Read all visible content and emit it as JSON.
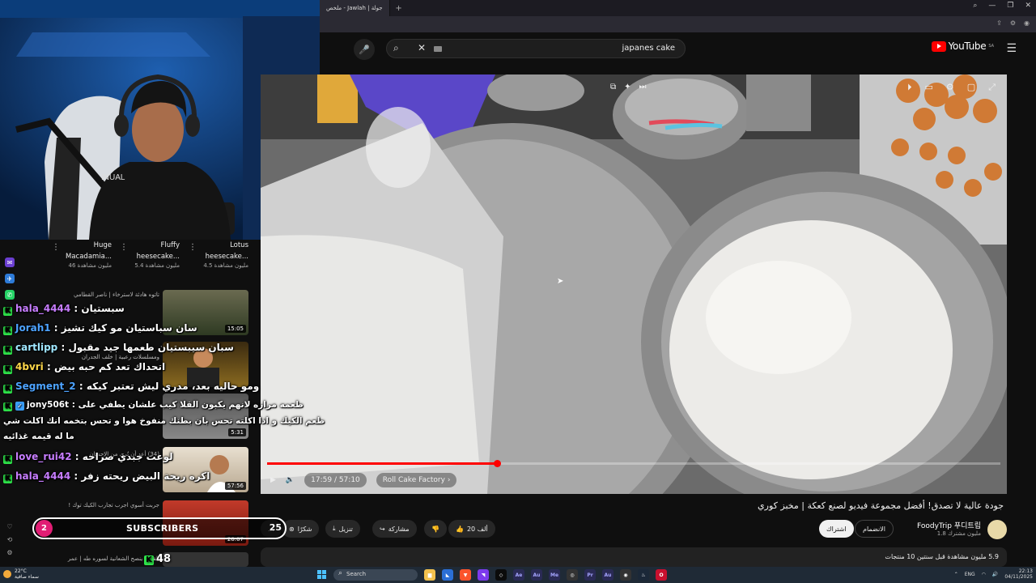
{
  "browser": {
    "tab_title": "ملخص - Jawlah | جولة",
    "tab_plus": "+",
    "win_min": "—",
    "win_max": "❐",
    "win_close": "✕",
    "search_zoom": "⌕"
  },
  "youtube": {
    "search_query": "japanes cake",
    "logo_text": "YouTube",
    "logo_region": "SA"
  },
  "player": {
    "time": "17:59 / 57:10",
    "chapter": "Roll Cake Factory",
    "progress_fraction": 0.314
  },
  "video": {
    "title": "جودة عالية لا تصدق! أفضل مجموعة فيديو لصنع كعكة | مخبز كوري",
    "channel_name": "FoodyTrip 푸디트립",
    "channel_subs": "1.8 مليون مشترك",
    "join_label": "الانضمام",
    "subscribe_label": "اشتراك",
    "like_count": "20 ألف",
    "share_label": "مشاركة",
    "download_label": "تنزيل",
    "thanks_label": "شكرًا",
    "more_label": "...",
    "description": "5.9 مليون مشاهدة  قبل سنتين  10 منتجات"
  },
  "recs_top": [
    {
      "title": "Huge",
      "title2": "Macadamia...",
      "views": "46 مليون مشاهدة"
    },
    {
      "title": "Fluffy",
      "title2": "heesecake...",
      "views": "5.4 مليون مشاهدة"
    },
    {
      "title": "Lotus",
      "title2": "heesecake...",
      "views": "4.5 مليون مشاهدة"
    }
  ],
  "recs": [
    {
      "meta": "تاتوه هادئة لاسترخاء | ناصر القطامي",
      "duration": "15:05"
    },
    {
      "meta": "ومسلسلات رعبية | خلف الجدران",
      "duration": ""
    },
    {
      "meta": "ديمبيلي 2, بطيء الحيوي",
      "duration": "5:31"
    },
    {
      "meta": "(34) أعد أن تُرى من الإحسان",
      "duration": "57:56"
    },
    {
      "meta": "جربت أسوي اجرب تجارب الكيك توك !",
      "duration": "26:07"
    },
    {
      "meta": "القارئ ينصح الشعانية لسوره طه | عمر",
      "duration": ""
    }
  ],
  "chat": [
    {
      "user": "hala_4444",
      "color": "#c77dff",
      "text": "سبستيان"
    },
    {
      "user": "Jorah1",
      "color": "#4da3ff",
      "text": "سان سباستيان مو كيك تشيز"
    },
    {
      "user": "cartlipp",
      "color": "#a0e7ff",
      "text": "سبان سيبستيان طعمها جيد مقبول"
    },
    {
      "user": "4bvri",
      "color": "#ffd84a",
      "text": "اتحداك تعد كم حبه بيض"
    },
    {
      "user": "Segment_2",
      "color": "#4da3ff",
      "text": "ومو حاليه بعد، مدري ليش تعتبر كيكه"
    },
    {
      "user": "jony506t",
      "color": "#ffffff",
      "text": "طعمه مراره لانهم يكبون القلا كيب علشان يطفي على"
    },
    {
      "user": "",
      "color": "#ffffff",
      "text": "طعم الكيك و اذا اكلته تحس بان بطنك منفوخ هوا و تحس بتخمه انك اكلت شي"
    },
    {
      "user": "",
      "color": "#ffffff",
      "text": "ما له قيمه غذائيه"
    },
    {
      "user": "love_rui42",
      "color": "#c77dff",
      "text": "لوعت جبدي صراحه"
    },
    {
      "user": "hala_4444",
      "color": "#c77dff",
      "text": "اكره ريحة البيض ريحته زفر"
    }
  ],
  "widget": {
    "left_count": "2",
    "label": "SUBSCRIBERS",
    "right_count": "25",
    "kick_count": "48"
  },
  "taskbar": {
    "temp": "22°C",
    "weather": "سماء صافية",
    "search_placeholder": "Search",
    "lang": "ENG",
    "time": "22:13",
    "date": "04/11/2025"
  }
}
